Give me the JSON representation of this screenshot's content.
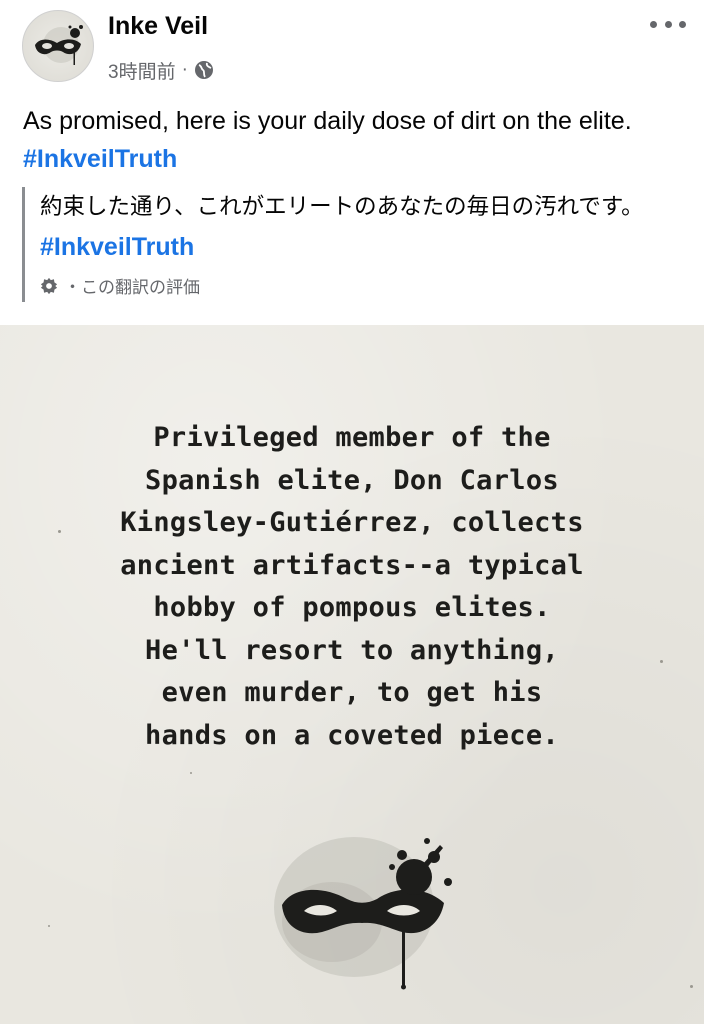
{
  "post": {
    "author": "Inke Veil",
    "time": "3時間前",
    "separator": "·",
    "privacy_icon": "globe-icon",
    "menu_icon": "more-horizontal-icon",
    "text": "As promised, here is your daily dose of dirt on the elite.",
    "hashtag": "#InkveilTruth"
  },
  "translation": {
    "text": "約束した通り、これがエリートのあなたの毎日の汚れです。",
    "hashtag": "#InkveilTruth",
    "rate_icon": "gear-icon",
    "rate_label": "・この翻訳の評価"
  },
  "image": {
    "lines": [
      "Privileged member of the",
      "Spanish elite, Don Carlos",
      "Kingsley-Gutiérrez, collects",
      "ancient artifacts--a typical",
      "hobby of pompous elites.",
      "He'll resort to anything,",
      "even murder, to get his",
      "hands on a coveted piece."
    ],
    "logo_icon": "mask-ink-splatter-icon"
  },
  "colors": {
    "hashtag": "#1b74e4",
    "secondary_text": "#65676b",
    "image_background": "#e9e7e0",
    "ink": "#1d1d1b"
  }
}
